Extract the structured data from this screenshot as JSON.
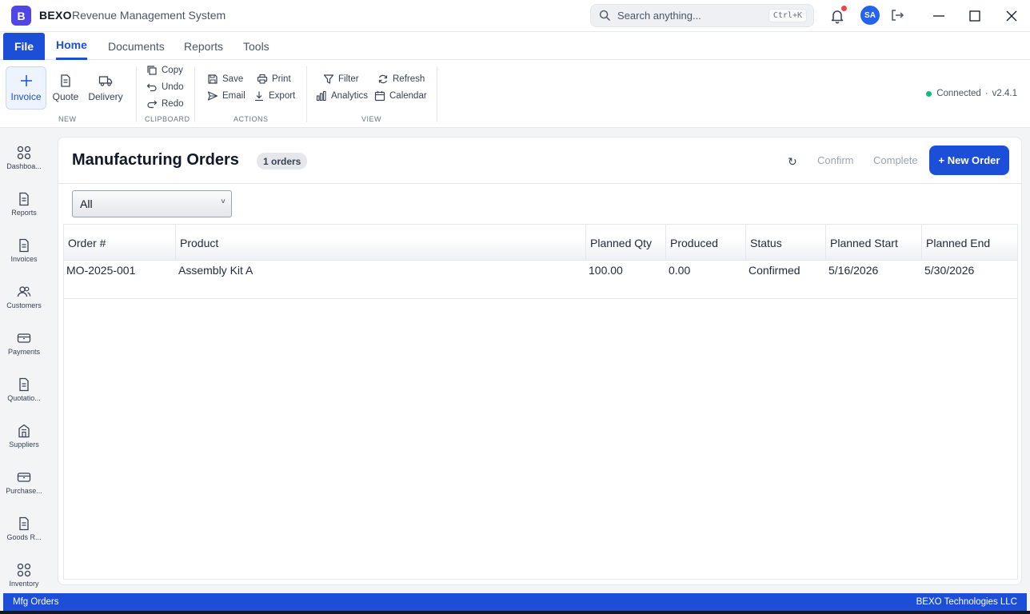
{
  "titlebar": {
    "logo_letter": "B",
    "brand": "BEXO",
    "subtitle": "Revenue Management System",
    "search_placeholder": "Search anything...",
    "search_shortcut": "Ctrl+K",
    "avatar_initials": "SA"
  },
  "tabs": {
    "file": "File",
    "items": [
      "Home",
      "Documents",
      "Reports",
      "Tools"
    ],
    "active": "Home"
  },
  "ribbon": {
    "new": {
      "label": "NEW",
      "invoice": "Invoice",
      "quote": "Quote",
      "delivery": "Delivery"
    },
    "clipboard": {
      "label": "CLIPBOARD",
      "copy": "Copy",
      "undo": "Undo",
      "redo": "Redo"
    },
    "actions": {
      "label": "ACTIONS",
      "save": "Save",
      "print": "Print",
      "email": "Email",
      "export": "Export"
    },
    "view": {
      "label": "VIEW",
      "filter": "Filter",
      "refresh": "Refresh",
      "analytics": "Analytics",
      "calendar": "Calendar"
    },
    "status": {
      "connection": "Connected",
      "separator": "·",
      "version": "v2.4.1"
    }
  },
  "sidebar": {
    "items": [
      {
        "label": "Dashboa...",
        "icon": "grid-icon"
      },
      {
        "label": "Reports",
        "icon": "document-icon"
      },
      {
        "label": "Invoices",
        "icon": "document-icon"
      },
      {
        "label": "Customers",
        "icon": "users-icon"
      },
      {
        "label": "Payments",
        "icon": "wallet-icon"
      },
      {
        "label": "Quotatio...",
        "icon": "document-icon"
      },
      {
        "label": "Suppliers",
        "icon": "building-icon"
      },
      {
        "label": "Purchase...",
        "icon": "wallet-icon"
      },
      {
        "label": "Goods R...",
        "icon": "document-icon"
      },
      {
        "label": "Inventory",
        "icon": "grid-icon"
      }
    ]
  },
  "main": {
    "title": "Manufacturing Orders",
    "count_badge": "1 orders",
    "refresh_symbol": "↻",
    "confirm_label": "Confirm",
    "complete_label": "Complete",
    "new_order_label": "+ New Order",
    "filter_value": "All",
    "filter_caret": "˅",
    "table": {
      "columns": [
        "Order #",
        "Product",
        "Planned Qty",
        "Produced",
        "Status",
        "Planned Start",
        "Planned End"
      ],
      "rows": [
        [
          "MO-2025-001",
          "Assembly Kit A",
          "100.00",
          "0.00",
          "Confirmed",
          "5/16/2026",
          "5/30/2026"
        ]
      ]
    }
  },
  "footer": {
    "left": "Mfg Orders",
    "right": "BEXO Technologies LLC"
  },
  "colors": {
    "accent": "#1d4ed8",
    "logo": "#4f46e5",
    "status_ok": "#10b981",
    "notification": "#ef4444"
  }
}
